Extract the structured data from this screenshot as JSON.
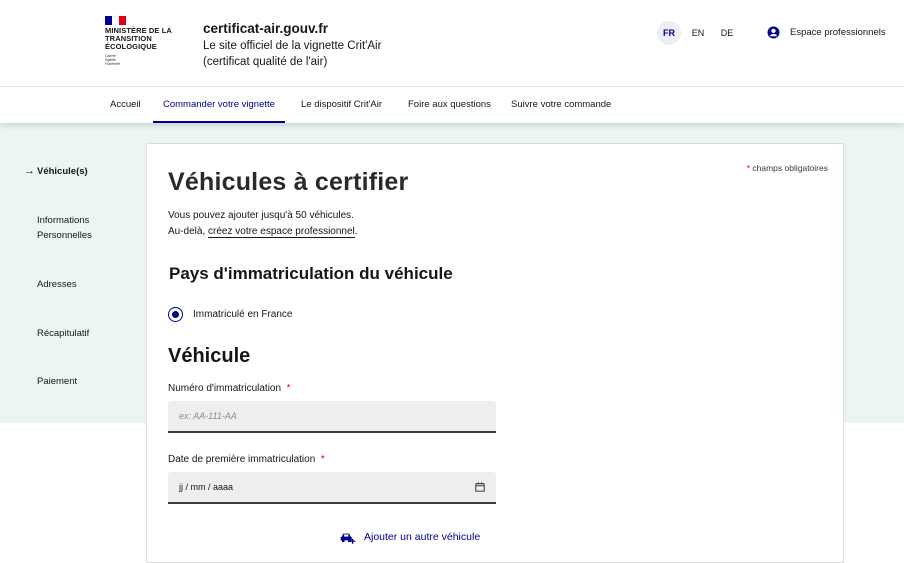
{
  "header": {
    "ministry": "MINISTÈRE DE LA TRANSITION ÉCOLOGIQUE",
    "devise": [
      "Liberté",
      "Égalité",
      "Fraternité"
    ],
    "site_title": "certificat-air.gouv.fr",
    "tagline": "Le site officiel de la vignette Crit'Air (certificat qualité de l'air)",
    "languages": [
      {
        "code": "FR",
        "active": true
      },
      {
        "code": "EN",
        "active": false
      },
      {
        "code": "DE",
        "active": false
      }
    ],
    "pro_space": "Espace professionnels",
    "pro_icon": "user-circle-icon"
  },
  "nav": {
    "items": [
      {
        "label": "Accueil",
        "active": false
      },
      {
        "label": "Commander votre vignette",
        "active": true
      },
      {
        "label": "Le dispositif Crit'Air",
        "active": false
      },
      {
        "label": "Foire aux questions",
        "active": false
      },
      {
        "label": "Suivre votre commande",
        "active": false
      }
    ]
  },
  "sidebar": {
    "items": [
      {
        "label": "Véhicule(s)",
        "active": true
      },
      {
        "label": "Informations Personnelles",
        "active": false
      },
      {
        "label": "Adresses",
        "active": false
      },
      {
        "label": "Récapitulatif",
        "active": false
      },
      {
        "label": "Paiement",
        "active": false
      }
    ]
  },
  "form": {
    "required_note_star": "*",
    "required_note": "champs obligatoires",
    "title": "Véhicules à certifier",
    "intro_line1": "Vous pouvez ajouter jusqu'à 50 véhicules.",
    "intro_line2_prefix": "Au-delà, ",
    "intro_link": "créez votre espace professionnel",
    "intro_line2_suffix": ".",
    "country_heading": "Pays d'immatriculation du véhicule",
    "country_option": "Immatriculé en France",
    "vehicle_heading": "Véhicule",
    "plate_label": "Numéro d'immatriculation",
    "plate_placeholder": "ex: AA-111-AA",
    "plate_value": "",
    "date_label": "Date de première immatriculation",
    "date_placeholder": "jj / mm / aaaa",
    "add_vehicle": "Ajouter un autre véhicule"
  },
  "colors": {
    "primary": "#000091",
    "required": "#e1000f",
    "band_bg": "#ecf5f2",
    "flag_blue": "#000091",
    "flag_red": "#e1000f"
  }
}
